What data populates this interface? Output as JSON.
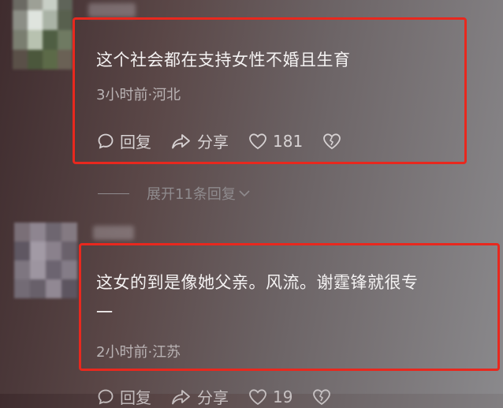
{
  "comments": [
    {
      "text": "这个社会都在支持女性不婚且生育",
      "meta": "3小时前·河北",
      "actions": {
        "reply": "回复",
        "share": "分享",
        "likes": "181"
      },
      "more_replies": "展开11条回复"
    },
    {
      "text_line1": "这女的到是像她父亲。风流。谢霆锋就很专",
      "text_line2": "一",
      "meta": "2小时前·江苏",
      "actions": {
        "reply": "回复",
        "share": "分享",
        "likes": "19"
      }
    }
  ],
  "colors": {
    "highlight": "#e8281e"
  }
}
